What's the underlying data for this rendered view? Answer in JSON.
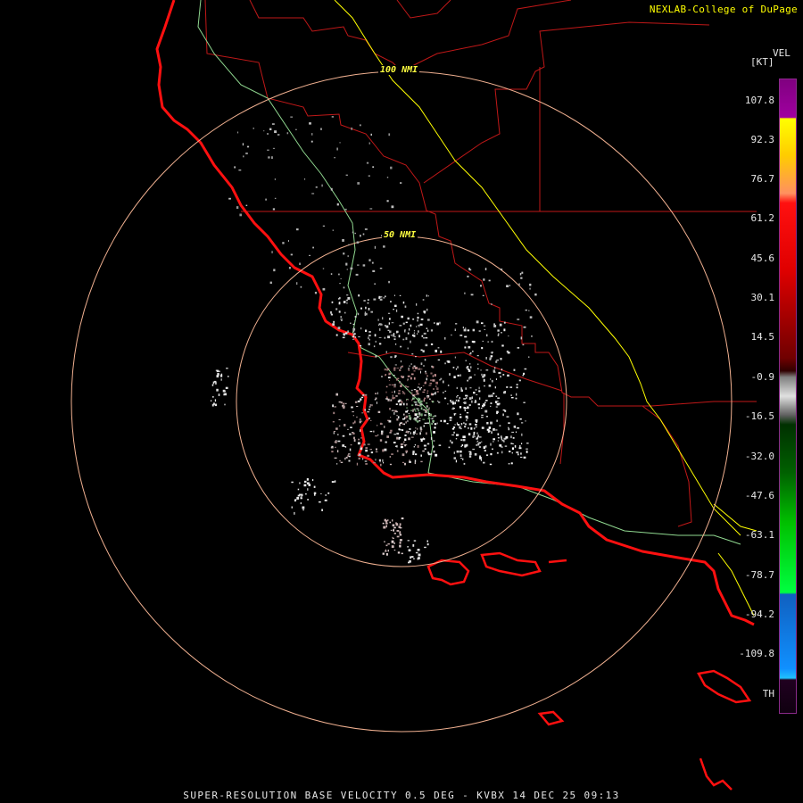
{
  "credit": "NEXLAB-College of DuPage",
  "product_footer": "SUPER-RESOLUTION BASE VELOCITY 0.5 DEG - KVBX 14 DEC 25 09:13",
  "range_rings": [
    "100 NMI",
    "50 NMI"
  ],
  "legend": {
    "title": "VEL",
    "unit": "[KT]",
    "ticks": [
      "107.8",
      "92.3",
      "76.7",
      "61.2",
      "45.6",
      "30.1",
      "14.5",
      "-0.9",
      "-16.5",
      "-32.0",
      "-47.6",
      "-63.1",
      "-78.7",
      "-94.2",
      "-109.8",
      "TH"
    ]
  },
  "colors": {
    "text": "#e6e6e6",
    "credit": "#ffff00",
    "ring": "#f0b090",
    "ring_label": "#ffff40",
    "coast": "#ff1010",
    "border": "#c01818",
    "highway": "#ffff00",
    "road": "#90d890"
  }
}
